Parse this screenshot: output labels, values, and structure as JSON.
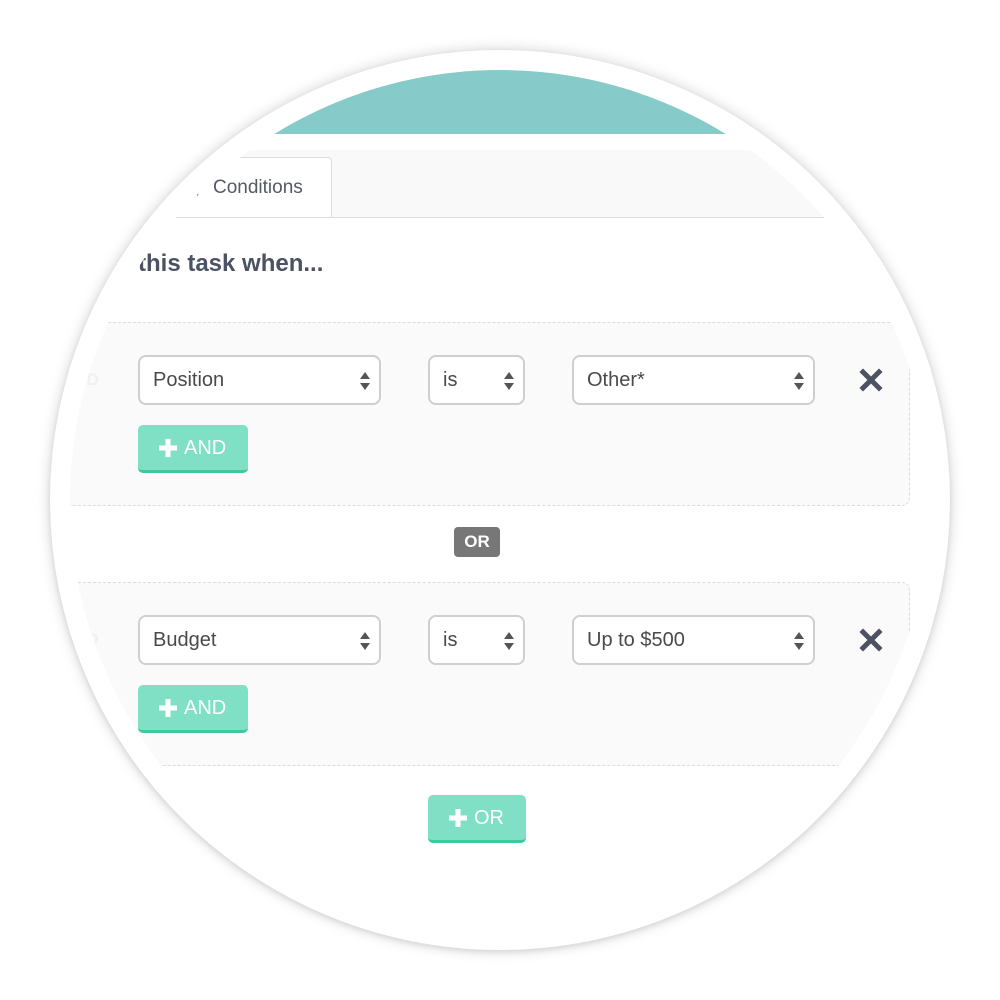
{
  "tabs": [
    {
      "prefix": ",",
      "label": "Conditions",
      "active": true
    }
  ],
  "main": {
    "heading": "this task when...",
    "heading_partial": "hen...",
    "groups": [
      {
        "connector_label": "AND",
        "condition": {
          "field": "Position",
          "operator": "is",
          "value": "Other*"
        },
        "add_and_label": "AND"
      },
      {
        "connector_label": "AND",
        "condition": {
          "field": "Budget",
          "operator": "is",
          "value": "Up to $500"
        },
        "add_and_label": "AND"
      }
    ],
    "or_separator": "OR",
    "add_or_label": "OR"
  },
  "icons": {
    "remove": "close-x-icon",
    "add": "plus-icon",
    "select_arrows": "updown-arrows-icon"
  },
  "colors": {
    "header_band": "#86cbca",
    "add_button": "#80e0c5",
    "add_button_border": "#3cc99d",
    "or_badge": "#777777",
    "heading_text": "#4b5261"
  }
}
